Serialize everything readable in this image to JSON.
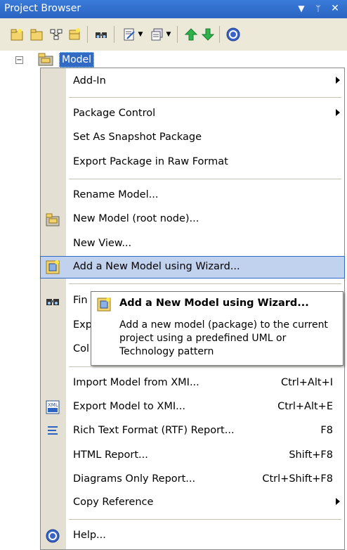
{
  "window": {
    "title": "Project Browser"
  },
  "title_controls": [
    "dropdown-icon",
    "pin-icon",
    "close-icon"
  ],
  "toolbar": {
    "buttons": [
      "new-package-icon",
      "new-view-icon",
      "new-diagram-icon",
      "new-element-icon",
      "find-icon",
      "properties-icon",
      "dropdown-icon",
      "document-icon",
      "dropdown-icon",
      "move-up-icon",
      "move-down-icon",
      "help-icon"
    ]
  },
  "tree": {
    "root_label": "Model",
    "expander": "−"
  },
  "menu": {
    "items": [
      {
        "label": "Add-In",
        "shortcut": "",
        "submenu": true
      },
      {
        "label": "Package Control",
        "shortcut": "",
        "submenu": true
      },
      {
        "label": "Set As Snapshot Package",
        "shortcut": "",
        "submenu": false
      },
      {
        "label": "Export Package in Raw Format",
        "shortcut": "",
        "submenu": false
      },
      {
        "label": "Rename Model...",
        "shortcut": "",
        "submenu": false
      },
      {
        "label": "New Model (root node)...",
        "shortcut": "",
        "submenu": false
      },
      {
        "label": "New View...",
        "shortcut": "",
        "submenu": false
      },
      {
        "label": "Add a New Model using Wizard...",
        "shortcut": "",
        "submenu": false
      },
      {
        "label": "Fin",
        "shortcut": "",
        "submenu": false
      },
      {
        "label": "Exp",
        "shortcut": "",
        "submenu": false
      },
      {
        "label": "Col",
        "shortcut": "",
        "submenu": false
      },
      {
        "label": "Import Model from XMI...",
        "shortcut": "Ctrl+Alt+I",
        "submenu": false
      },
      {
        "label": "Export Model to XMI...",
        "shortcut": "Ctrl+Alt+E",
        "submenu": false
      },
      {
        "label": "Rich Text Format (RTF) Report...",
        "shortcut": "F8",
        "submenu": false
      },
      {
        "label": "HTML Report...",
        "shortcut": "Shift+F8",
        "submenu": false
      },
      {
        "label": "Diagrams Only Report...",
        "shortcut": "Ctrl+Shift+F8",
        "submenu": false
      },
      {
        "label": "Copy Reference",
        "shortcut": "",
        "submenu": true
      },
      {
        "label": "Help...",
        "shortcut": "",
        "submenu": false
      }
    ]
  },
  "tooltip": {
    "title": "Add a New Model using Wizard...",
    "body": "Add a new model (package) to the current project using a predefined UML or Technology pattern"
  },
  "colors": {
    "title_bar": "#2f6fd0",
    "highlight": "#c1d2ee",
    "selection": "#316ac5",
    "gutter": "#e3e0d3"
  }
}
